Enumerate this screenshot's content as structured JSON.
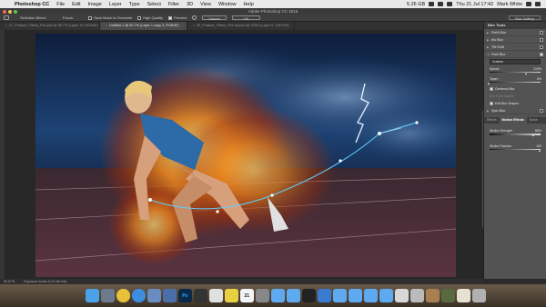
{
  "menubar": {
    "apple_glyph": "",
    "items": [
      "Photoshop CC",
      "File",
      "Edit",
      "Image",
      "Layer",
      "Type",
      "Select",
      "Filter",
      "3D",
      "View",
      "Window",
      "Help"
    ],
    "status": {
      "storage": "5.26 GB",
      "clock": "Thu 21 Jul  17:42",
      "user": "Mark White"
    }
  },
  "window": {
    "title": "Adobe Photoshop CC 2015"
  },
  "options": {
    "selection_bleed": "Selection Bleed:",
    "focus": "Focus:",
    "save_mask": "Save Mask to Channels",
    "high_quality": "High Quality",
    "preview": "Preview",
    "cancel": "Cancel",
    "ok": "OK",
    "workspace": "Blur Gallery"
  },
  "tabs": [
    {
      "label": "07_Feature_Filters_Fire.psd @ 66.7% (Layer 16, RGB/8*)",
      "active": false
    },
    {
      "label": "Untitled-1 @ 62.7% (Layer 1 copy 3, RGB/8*)",
      "active": true
    },
    {
      "label": "05_Feature_Filters_Fire bw.psd @ 100% (Layer 0, CMYK/8)",
      "active": false
    }
  ],
  "panel": {
    "title": "Blur Tools",
    "blur_tools": [
      {
        "label": "Field Blur",
        "checked": false
      },
      {
        "label": "Iris Blur",
        "checked": false
      },
      {
        "label": "Tilt-Shift",
        "checked": false
      },
      {
        "label": "Path Blur",
        "checked": true
      }
    ],
    "preset": "Custom",
    "speed_label": "Speed:",
    "speed_value": "219%",
    "speed_level": 0.72,
    "taper_label": "Taper:",
    "taper_value": "0%",
    "taper_level": 0.0,
    "centered_blur": "Centered Blur",
    "end_point_speed": "End Point Speed:",
    "edit_blur_shapes": "Edit Blur Shapes",
    "spin_blur": "Spin Blur",
    "effect_tabs": [
      "Effects",
      "Motion Effects",
      "Noise"
    ],
    "strobe_strength_label": "Strobe Strength:",
    "strobe_strength_value": "86%",
    "strobe_strength_level": 0.86,
    "strobe_flashes_label": "Strobe Flashes:",
    "strobe_flashes_value": "100",
    "strobe_flashes_level": 1.0
  },
  "statusbar": {
    "zoom": "62.67%",
    "doc": "Exposure works in 32-bit only"
  },
  "dock": {
    "calendar_day": "21",
    "photoshop_label": "Ps",
    "colors": {
      "finder": "#4aa3e8",
      "launchpad": "#6c7a90",
      "chrome": "#e8c13a",
      "safari": "#3d8ee0",
      "photoshop": "#0b2a4a",
      "folder": "#5eaaf0",
      "trash": "#bbbbbb"
    }
  }
}
